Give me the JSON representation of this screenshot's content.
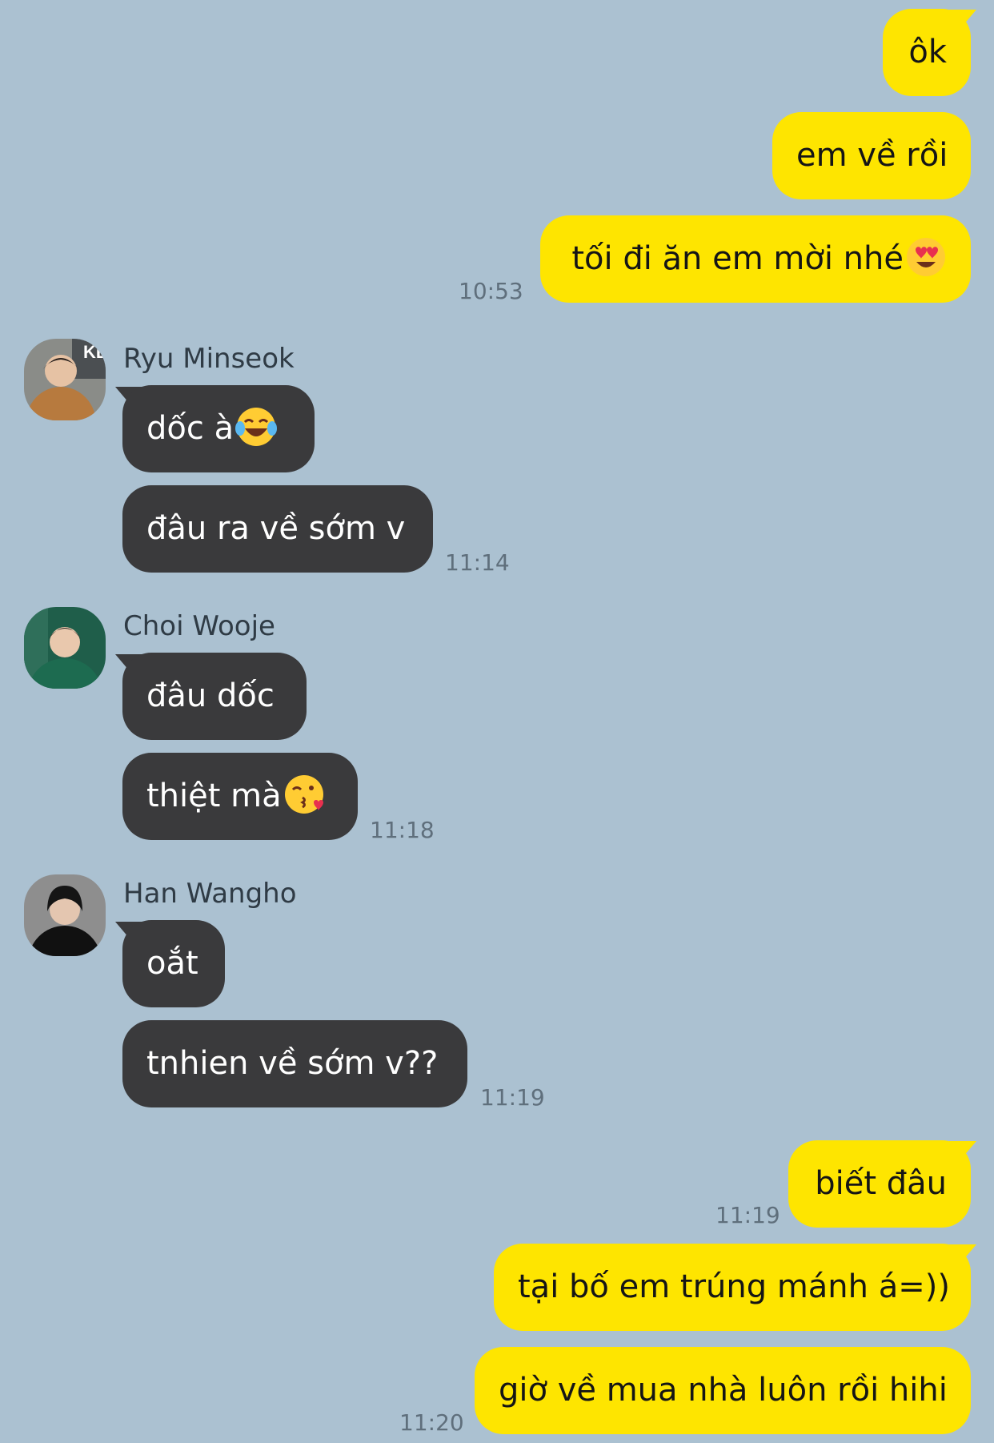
{
  "messages": [
    {
      "text": "ôk"
    },
    {
      "text": "em về rồi"
    },
    {
      "text": "tối đi ăn em mời nhé",
      "emoji": "heart-eyes-emoji",
      "time": "10:53"
    },
    {
      "sender": "Ryu Minseok",
      "avatar": "avatar-photo-ryu-minseok",
      "text": "dốc à",
      "emoji": "tears-of-joy-emoji"
    },
    {
      "text": "đâu ra về sớm v",
      "time": "11:14"
    },
    {
      "sender": "Choi Wooje",
      "avatar": "avatar-photo-choi-wooje",
      "text": "đâu dốc"
    },
    {
      "text": "thiệt mà",
      "emoji": "kissing-heart-emoji",
      "time": "11:18"
    },
    {
      "sender": "Han Wangho",
      "avatar": "avatar-photo-han-wangho",
      "text": "oắt"
    },
    {
      "text": "tnhien về sớm v??",
      "time": "11:19"
    },
    {
      "text": "biết đâu",
      "time": "11:19"
    },
    {
      "text": "tại bố em trúng mánh á=))"
    },
    {
      "text": "giờ về mua nhà luôn rồi hihi",
      "time": "11:20"
    }
  ],
  "colors": {
    "background": "#abc1d1",
    "outgoing_bubble": "#fee500",
    "incoming_bubble": "#3a3a3c"
  }
}
